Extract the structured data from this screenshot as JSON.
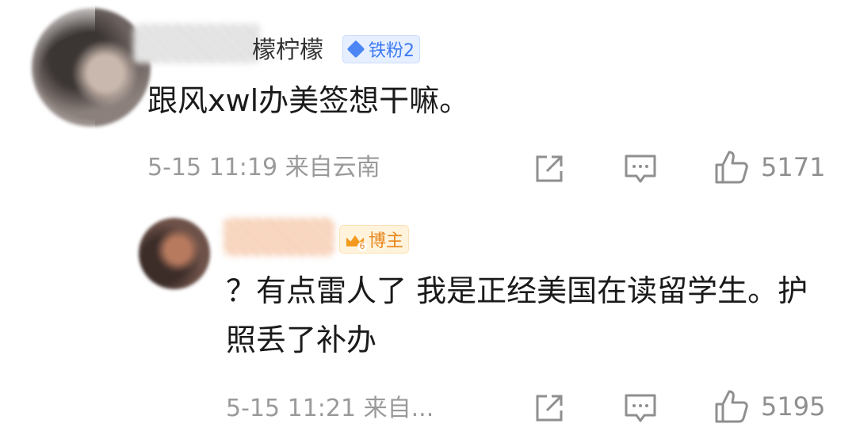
{
  "comments": [
    {
      "name_suffix": "檬柠檬",
      "badge": "铁粉2",
      "text": "跟风xwl办美签想干嘛。",
      "time": "5-15 11:19",
      "location": "来自云南",
      "like_count": "5171"
    },
    {
      "badge": "博主",
      "badge_level": "6",
      "text": "？有点雷人了 我是正经美国在读留学生。护照丢了补办",
      "time": "5-15 11:21",
      "location": "来自...",
      "like_count": "5195"
    }
  ],
  "icons": [
    "share-icon",
    "comment-icon",
    "like-icon",
    "diamond-icon",
    "crown-icon"
  ],
  "colors": {
    "fan_badge": "#3d7af2",
    "host_badge": "#e8861b",
    "meta_text": "#9a9a9a"
  }
}
